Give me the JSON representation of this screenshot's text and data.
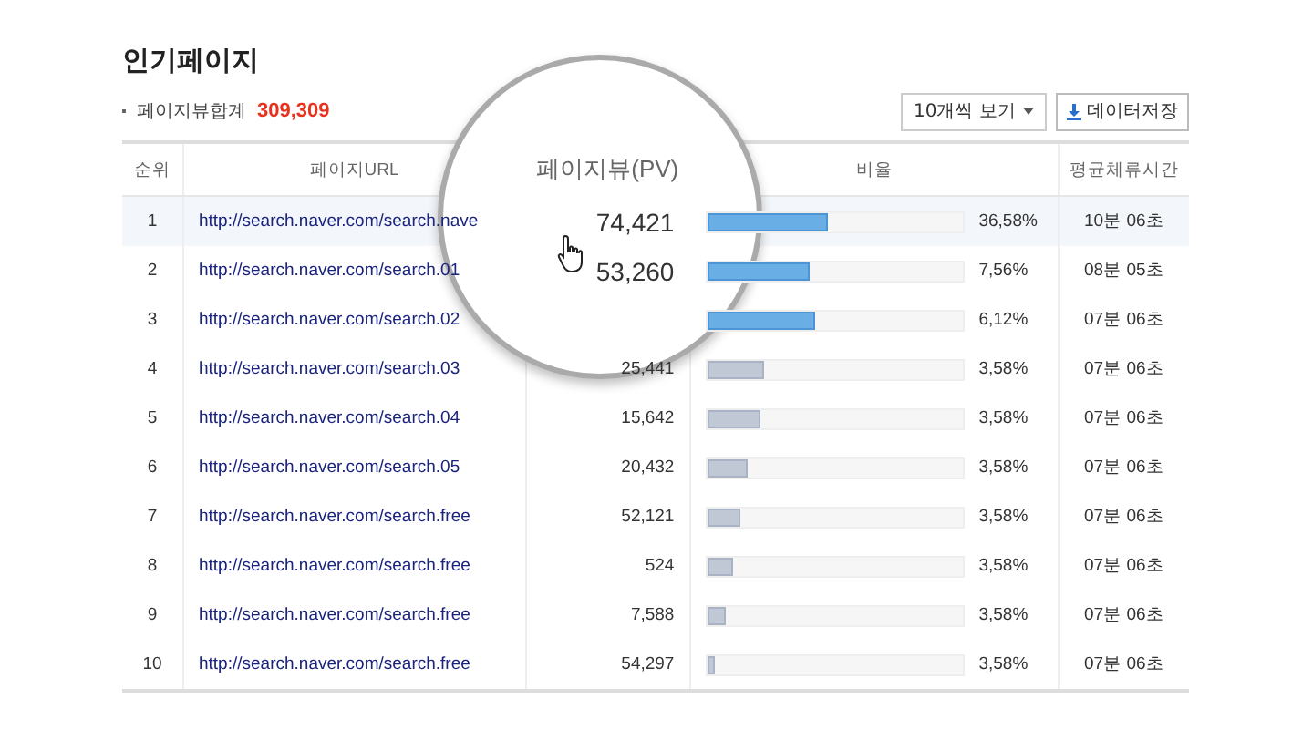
{
  "title": "인기페이지",
  "summary": {
    "label": "페이지뷰합계",
    "value": "309,309"
  },
  "toolbar": {
    "view_select": "10개씩 보기",
    "download_button": "데이터저장"
  },
  "table": {
    "columns": [
      {
        "label": "순위",
        "magnified": false
      },
      {
        "label": "페이지URL",
        "magnified": false
      },
      {
        "label": "페이지뷰(PV)",
        "magnified": true
      },
      {
        "label": "비율",
        "magnified": false
      },
      {
        "label": "평균체류시간",
        "magnified": false
      }
    ],
    "rows": [
      {
        "rank": "1",
        "url": "http://search.naver.com/search.nave",
        "pv": "74,421",
        "magnified": true,
        "level": 0.47,
        "highlight": true,
        "ratio": "36,58%",
        "time": "10분 06초",
        "selected": true
      },
      {
        "rank": "2",
        "url": "http://search.naver.com/search.01",
        "pv": "53,260",
        "magnified": true,
        "level": 0.4,
        "highlight": true,
        "ratio": "7,56%",
        "time": "08분 05초",
        "selected": false
      },
      {
        "rank": "3",
        "url": "http://search.naver.com/search.02",
        "level": 0.42,
        "highlight": true,
        "ratio": "6,12%",
        "time": "07분 06초",
        "selected": false
      },
      {
        "rank": "4",
        "url": "http://search.naver.com/search.03",
        "pv": "25,441",
        "level": 0.22,
        "highlight": false,
        "ratio": "3,58%",
        "time": "07분 06초",
        "selected": false
      },
      {
        "rank": "5",
        "url": "http://search.naver.com/search.04",
        "pv": "15,642",
        "level": 0.21,
        "highlight": false,
        "ratio": "3,58%",
        "time": "07분 06초",
        "selected": false
      },
      {
        "rank": "6",
        "url": "http://search.naver.com/search.05",
        "pv": "20,432",
        "level": 0.16,
        "highlight": false,
        "ratio": "3,58%",
        "time": "07분 06초",
        "selected": false
      },
      {
        "rank": "7",
        "url": "http://search.naver.com/search.free",
        "pv": "52,121",
        "level": 0.13,
        "highlight": false,
        "ratio": "3,58%",
        "time": "07분 06초",
        "selected": false
      },
      {
        "rank": "8",
        "url": "http://search.naver.com/search.free",
        "pv": "524",
        "level": 0.1,
        "highlight": false,
        "ratio": "3,58%",
        "time": "07분 06초",
        "selected": false
      },
      {
        "rank": "9",
        "url": "http://search.naver.com/search.free",
        "pv": "7,588",
        "level": 0.07,
        "highlight": false,
        "ratio": "3,58%",
        "time": "07분 06초",
        "selected": false
      },
      {
        "rank": "10",
        "url": "http://search.naver.com/search.free",
        "pv": "54,297",
        "level": 0.03,
        "highlight": false,
        "ratio": "3,58%",
        "time": "07분 06초",
        "selected": false
      }
    ]
  }
}
